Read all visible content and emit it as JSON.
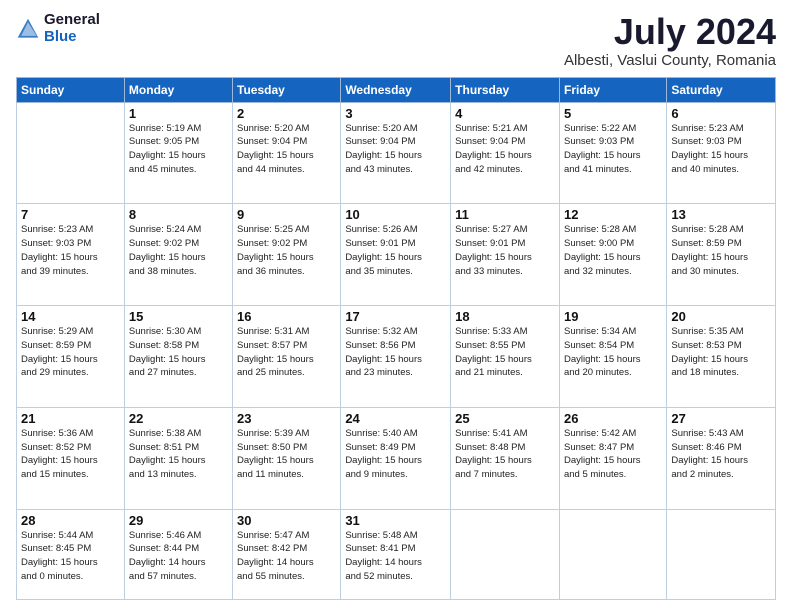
{
  "header": {
    "logo_general": "General",
    "logo_blue": "Blue",
    "month_title": "July 2024",
    "location": "Albesti, Vaslui County, Romania"
  },
  "weekdays": [
    "Sunday",
    "Monday",
    "Tuesday",
    "Wednesday",
    "Thursday",
    "Friday",
    "Saturday"
  ],
  "weeks": [
    [
      {
        "day": "",
        "sunrise": "",
        "sunset": "",
        "daylight": ""
      },
      {
        "day": "1",
        "sunrise": "Sunrise: 5:19 AM",
        "sunset": "Sunset: 9:05 PM",
        "daylight": "Daylight: 15 hours and 45 minutes."
      },
      {
        "day": "2",
        "sunrise": "Sunrise: 5:20 AM",
        "sunset": "Sunset: 9:04 PM",
        "daylight": "Daylight: 15 hours and 44 minutes."
      },
      {
        "day": "3",
        "sunrise": "Sunrise: 5:20 AM",
        "sunset": "Sunset: 9:04 PM",
        "daylight": "Daylight: 15 hours and 43 minutes."
      },
      {
        "day": "4",
        "sunrise": "Sunrise: 5:21 AM",
        "sunset": "Sunset: 9:04 PM",
        "daylight": "Daylight: 15 hours and 42 minutes."
      },
      {
        "day": "5",
        "sunrise": "Sunrise: 5:22 AM",
        "sunset": "Sunset: 9:03 PM",
        "daylight": "Daylight: 15 hours and 41 minutes."
      },
      {
        "day": "6",
        "sunrise": "Sunrise: 5:23 AM",
        "sunset": "Sunset: 9:03 PM",
        "daylight": "Daylight: 15 hours and 40 minutes."
      }
    ],
    [
      {
        "day": "7",
        "sunrise": "Sunrise: 5:23 AM",
        "sunset": "Sunset: 9:03 PM",
        "daylight": "Daylight: 15 hours and 39 minutes."
      },
      {
        "day": "8",
        "sunrise": "Sunrise: 5:24 AM",
        "sunset": "Sunset: 9:02 PM",
        "daylight": "Daylight: 15 hours and 38 minutes."
      },
      {
        "day": "9",
        "sunrise": "Sunrise: 5:25 AM",
        "sunset": "Sunset: 9:02 PM",
        "daylight": "Daylight: 15 hours and 36 minutes."
      },
      {
        "day": "10",
        "sunrise": "Sunrise: 5:26 AM",
        "sunset": "Sunset: 9:01 PM",
        "daylight": "Daylight: 15 hours and 35 minutes."
      },
      {
        "day": "11",
        "sunrise": "Sunrise: 5:27 AM",
        "sunset": "Sunset: 9:01 PM",
        "daylight": "Daylight: 15 hours and 33 minutes."
      },
      {
        "day": "12",
        "sunrise": "Sunrise: 5:28 AM",
        "sunset": "Sunset: 9:00 PM",
        "daylight": "Daylight: 15 hours and 32 minutes."
      },
      {
        "day": "13",
        "sunrise": "Sunrise: 5:28 AM",
        "sunset": "Sunset: 8:59 PM",
        "daylight": "Daylight: 15 hours and 30 minutes."
      }
    ],
    [
      {
        "day": "14",
        "sunrise": "Sunrise: 5:29 AM",
        "sunset": "Sunset: 8:59 PM",
        "daylight": "Daylight: 15 hours and 29 minutes."
      },
      {
        "day": "15",
        "sunrise": "Sunrise: 5:30 AM",
        "sunset": "Sunset: 8:58 PM",
        "daylight": "Daylight: 15 hours and 27 minutes."
      },
      {
        "day": "16",
        "sunrise": "Sunrise: 5:31 AM",
        "sunset": "Sunset: 8:57 PM",
        "daylight": "Daylight: 15 hours and 25 minutes."
      },
      {
        "day": "17",
        "sunrise": "Sunrise: 5:32 AM",
        "sunset": "Sunset: 8:56 PM",
        "daylight": "Daylight: 15 hours and 23 minutes."
      },
      {
        "day": "18",
        "sunrise": "Sunrise: 5:33 AM",
        "sunset": "Sunset: 8:55 PM",
        "daylight": "Daylight: 15 hours and 21 minutes."
      },
      {
        "day": "19",
        "sunrise": "Sunrise: 5:34 AM",
        "sunset": "Sunset: 8:54 PM",
        "daylight": "Daylight: 15 hours and 20 minutes."
      },
      {
        "day": "20",
        "sunrise": "Sunrise: 5:35 AM",
        "sunset": "Sunset: 8:53 PM",
        "daylight": "Daylight: 15 hours and 18 minutes."
      }
    ],
    [
      {
        "day": "21",
        "sunrise": "Sunrise: 5:36 AM",
        "sunset": "Sunset: 8:52 PM",
        "daylight": "Daylight: 15 hours and 15 minutes."
      },
      {
        "day": "22",
        "sunrise": "Sunrise: 5:38 AM",
        "sunset": "Sunset: 8:51 PM",
        "daylight": "Daylight: 15 hours and 13 minutes."
      },
      {
        "day": "23",
        "sunrise": "Sunrise: 5:39 AM",
        "sunset": "Sunset: 8:50 PM",
        "daylight": "Daylight: 15 hours and 11 minutes."
      },
      {
        "day": "24",
        "sunrise": "Sunrise: 5:40 AM",
        "sunset": "Sunset: 8:49 PM",
        "daylight": "Daylight: 15 hours and 9 minutes."
      },
      {
        "day": "25",
        "sunrise": "Sunrise: 5:41 AM",
        "sunset": "Sunset: 8:48 PM",
        "daylight": "Daylight: 15 hours and 7 minutes."
      },
      {
        "day": "26",
        "sunrise": "Sunrise: 5:42 AM",
        "sunset": "Sunset: 8:47 PM",
        "daylight": "Daylight: 15 hours and 5 minutes."
      },
      {
        "day": "27",
        "sunrise": "Sunrise: 5:43 AM",
        "sunset": "Sunset: 8:46 PM",
        "daylight": "Daylight: 15 hours and 2 minutes."
      }
    ],
    [
      {
        "day": "28",
        "sunrise": "Sunrise: 5:44 AM",
        "sunset": "Sunset: 8:45 PM",
        "daylight": "Daylight: 15 hours and 0 minutes."
      },
      {
        "day": "29",
        "sunrise": "Sunrise: 5:46 AM",
        "sunset": "Sunset: 8:44 PM",
        "daylight": "Daylight: 14 hours and 57 minutes."
      },
      {
        "day": "30",
        "sunrise": "Sunrise: 5:47 AM",
        "sunset": "Sunset: 8:42 PM",
        "daylight": "Daylight: 14 hours and 55 minutes."
      },
      {
        "day": "31",
        "sunrise": "Sunrise: 5:48 AM",
        "sunset": "Sunset: 8:41 PM",
        "daylight": "Daylight: 14 hours and 52 minutes."
      },
      {
        "day": "",
        "sunrise": "",
        "sunset": "",
        "daylight": ""
      },
      {
        "day": "",
        "sunrise": "",
        "sunset": "",
        "daylight": ""
      },
      {
        "day": "",
        "sunrise": "",
        "sunset": "",
        "daylight": ""
      }
    ]
  ]
}
